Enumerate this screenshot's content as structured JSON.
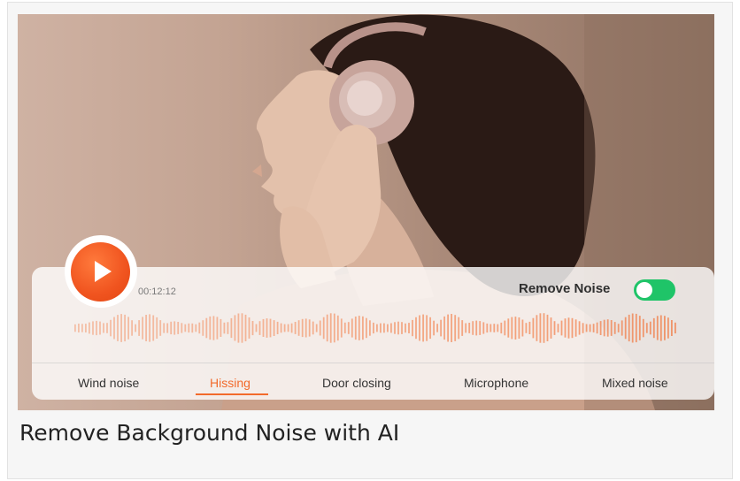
{
  "player": {
    "time": "00:12:12",
    "remove_noise_label": "Remove Noise",
    "remove_noise_on": true,
    "accent_color": "#f26a2b",
    "toggle_color": "#1fc468"
  },
  "tabs": [
    {
      "label": "Wind noise",
      "active": false
    },
    {
      "label": "Hissing",
      "active": true
    },
    {
      "label": "Door closing",
      "active": false
    },
    {
      "label": "Microphone",
      "active": false
    },
    {
      "label": "Mixed noise",
      "active": false
    }
  ],
  "caption": "Remove Background Noise with AI",
  "icons": {
    "play": "play-icon",
    "waveform": "waveform-icon",
    "toggle": "toggle-switch-icon"
  }
}
